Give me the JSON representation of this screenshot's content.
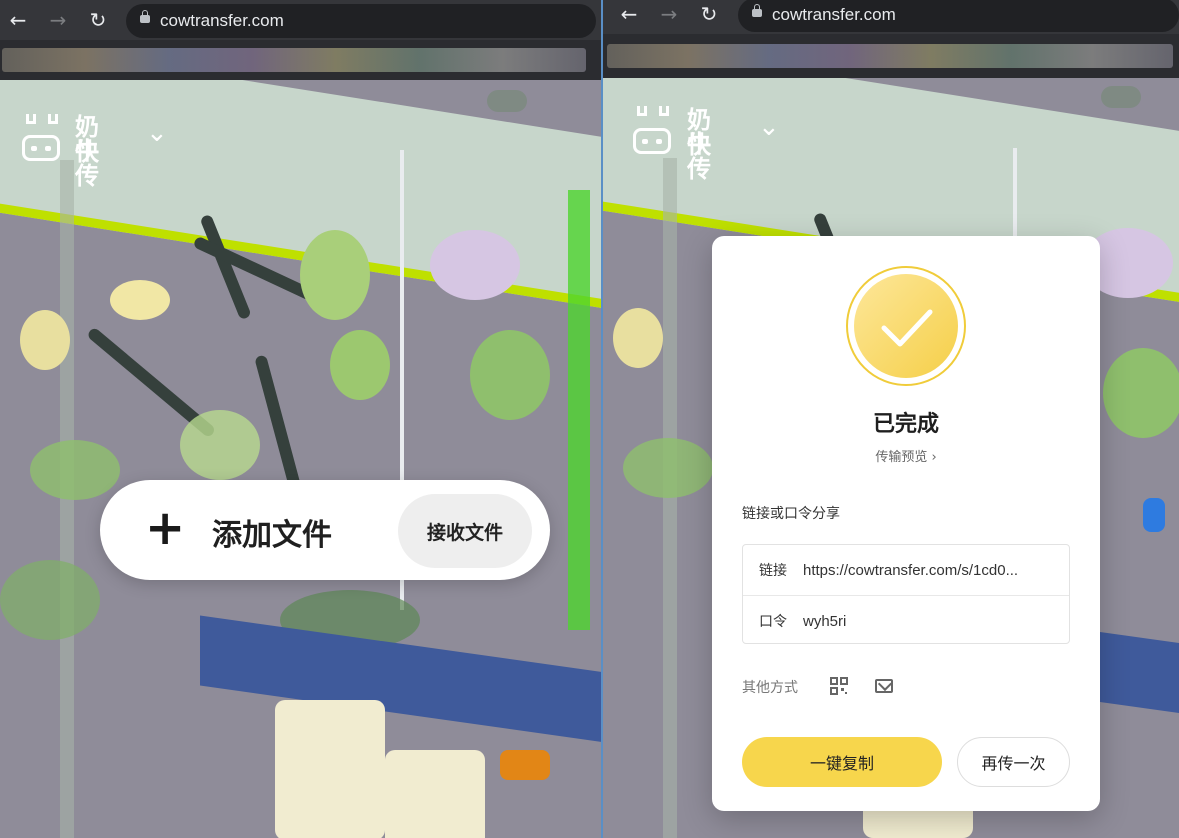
{
  "browser": {
    "url": "cowtransfer.com",
    "back_icon": "←",
    "forward_icon": "→",
    "reload_icon": "↻"
  },
  "brand": {
    "line1": "奶牛",
    "line2": "快传",
    "menu_icon": "⌄"
  },
  "upload": {
    "add_icon": "+",
    "add_label": "添加文件",
    "receive_label": "接收文件"
  },
  "result": {
    "title": "已完成",
    "preview_link": "传输预览 ›",
    "share_title": "链接或口令分享",
    "link_label": "链接",
    "link_value": "https://cowtransfer.com/s/1cd0...",
    "code_label": "口令",
    "code_value": "wyh5ri",
    "other_label": "其他方式",
    "copy_label": "一键复制",
    "again_label": "再传一次"
  },
  "colors": {
    "accent": "#f7d64c",
    "chrome": "#35363a"
  }
}
